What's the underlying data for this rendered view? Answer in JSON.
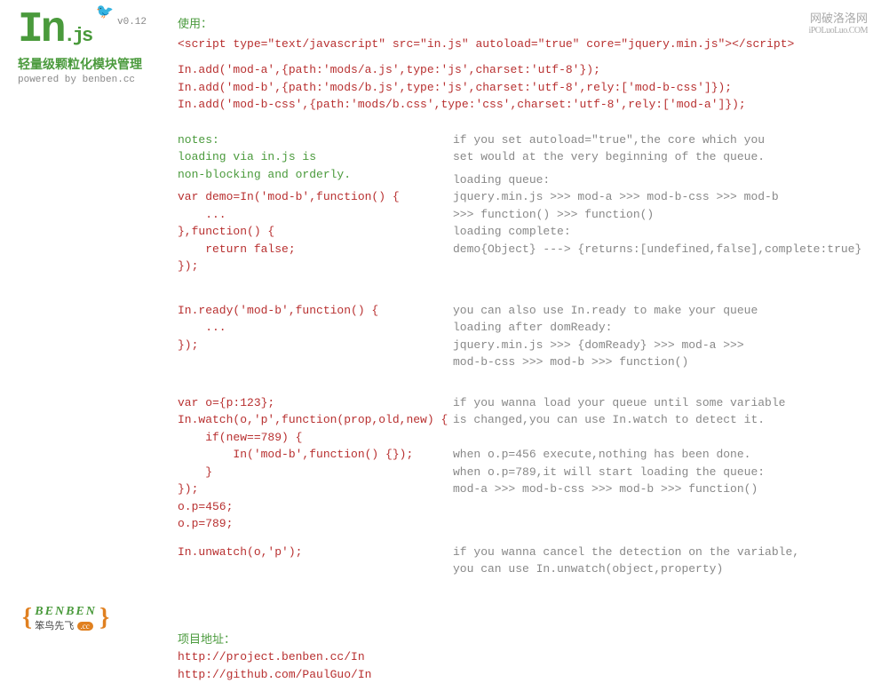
{
  "sidebar": {
    "logo_main": "In",
    "logo_ext": ".js",
    "logo_version": "v0.12",
    "bird": "🐦",
    "tagline": "轻量级颗粒化模块管理",
    "powered": "powered by benben.cc"
  },
  "watermark": {
    "cn": "网破洛洛网",
    "url": "iPOLuoLuo.COM"
  },
  "footer": {
    "brace_l": "{",
    "brace_r": "}",
    "benben": "BENBEN",
    "sub": "笨鸟先飞",
    "cc": ".cc"
  },
  "usage": {
    "title": "使用：",
    "script_line": "<script type=\"text/javascript\" src=\"in.js\" autoload=\"true\" core=\"jquery.min.js\"></script>",
    "add_lines": "In.add('mod-a',{path:'mods/a.js',type:'js',charset:'utf-8'});\nIn.add('mod-b',{path:'mods/b.js',type:'js',charset:'utf-8',rely:['mod-b-css']});\nIn.add('mod-b-css',{path:'mods/b.css',type:'css',charset:'utf-8',rely:['mod-a']});"
  },
  "notes": {
    "left": "notes:\nloading via in.js is\nnon-blocking and orderly.",
    "demo_code": "var demo=In('mod-b',function() {\n    ...\n},function() {\n    return false;\n});",
    "right1": "if you set autoload=\"true\",the core which you\nset would at the very beginning of the queue.",
    "right2": "loading queue:\njquery.min.js >>> mod-a >>> mod-b-css >>> mod-b\n>>> function() >>> function()\nloading complete:\ndemo{Object} ---> {returns:[undefined,false],complete:true}"
  },
  "ready": {
    "code": "In.ready('mod-b',function() {\n    ...\n});",
    "right": "you can also use In.ready to make your queue\nloading after domReady:\njquery.min.js >>> {domReady} >>> mod-a >>>\nmod-b-css >>> mod-b >>> function()"
  },
  "watch": {
    "code": "var o={p:123};\nIn.watch(o,'p',function(prop,old,new) {\n    if(new==789) {\n        In('mod-b',function() {});\n    }\n});\no.p=456;\no.p=789;",
    "right": "if you wanna load your queue until some variable\nis changed,you can use In.watch to detect it.\n\nwhen o.p=456 execute,nothing has been done.\nwhen o.p=789,it will start loading the queue:\nmod-a >>> mod-b-css >>> mod-b >>> function()"
  },
  "unwatch": {
    "code": "In.unwatch(o,'p');",
    "right": "if you wanna cancel the detection on the variable,\nyou can use In.unwatch(object,property)"
  },
  "project": {
    "title": "项目地址：",
    "url1": "http://project.benben.cc/In",
    "url2": "http://github.com/PaulGuo/In"
  }
}
